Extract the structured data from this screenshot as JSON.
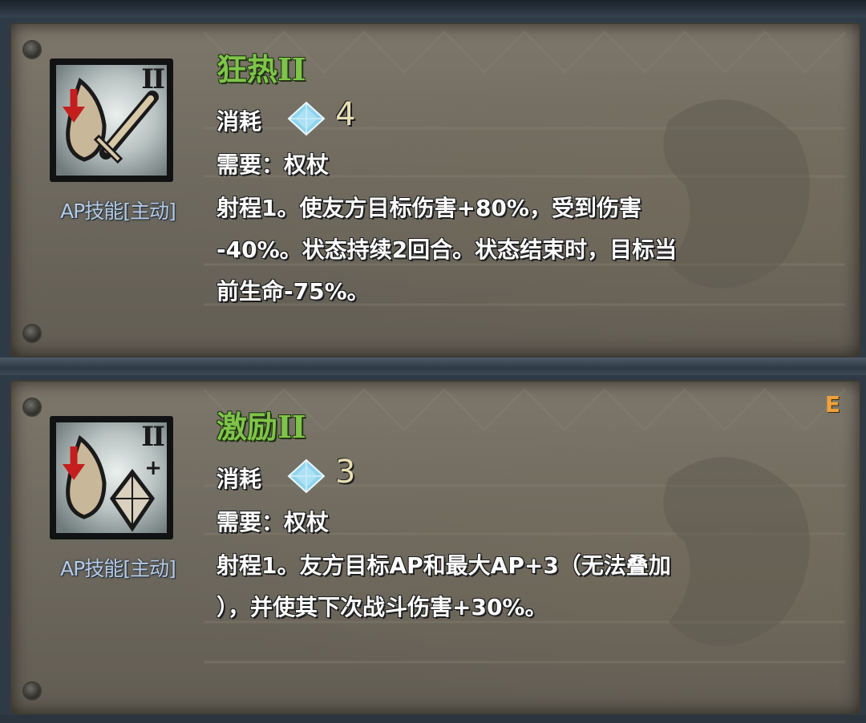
{
  "skills": [
    {
      "name": "狂热II",
      "tier": "II",
      "type_label": "AP技能[主动]",
      "cost_label": "消耗",
      "cost_value": "4",
      "cost_icon": "crystal-icon",
      "requirement": "需要：权杖",
      "description_lines": [
        "射程1。使友方目标伤害+80%，受到伤害",
        "-40%。状态持续2回合。状态结束时，目标当",
        "前生命-75%。"
      ],
      "icon": "fervor-sword-icon",
      "corner_tag": ""
    },
    {
      "name": "激励II",
      "tier": "II",
      "plus_badge": "+",
      "type_label": "AP技能[主动]",
      "cost_label": "消耗",
      "cost_value": "3",
      "cost_icon": "crystal-icon",
      "requirement": "需要：权杖",
      "description_lines": [
        "射程1。友方目标AP和最大AP+3（无法叠加",
        "），并使其下次战斗伤害+30%。"
      ],
      "icon": "inspire-crystal-icon",
      "corner_tag": "E"
    }
  ],
  "colors": {
    "title_green": "#7fc44a",
    "type_label_blue": "#b7cbe3",
    "cost_number": "#e9dfb3",
    "corner_tag_orange": "#f2a13a",
    "parchment": "#6f6a5f"
  }
}
